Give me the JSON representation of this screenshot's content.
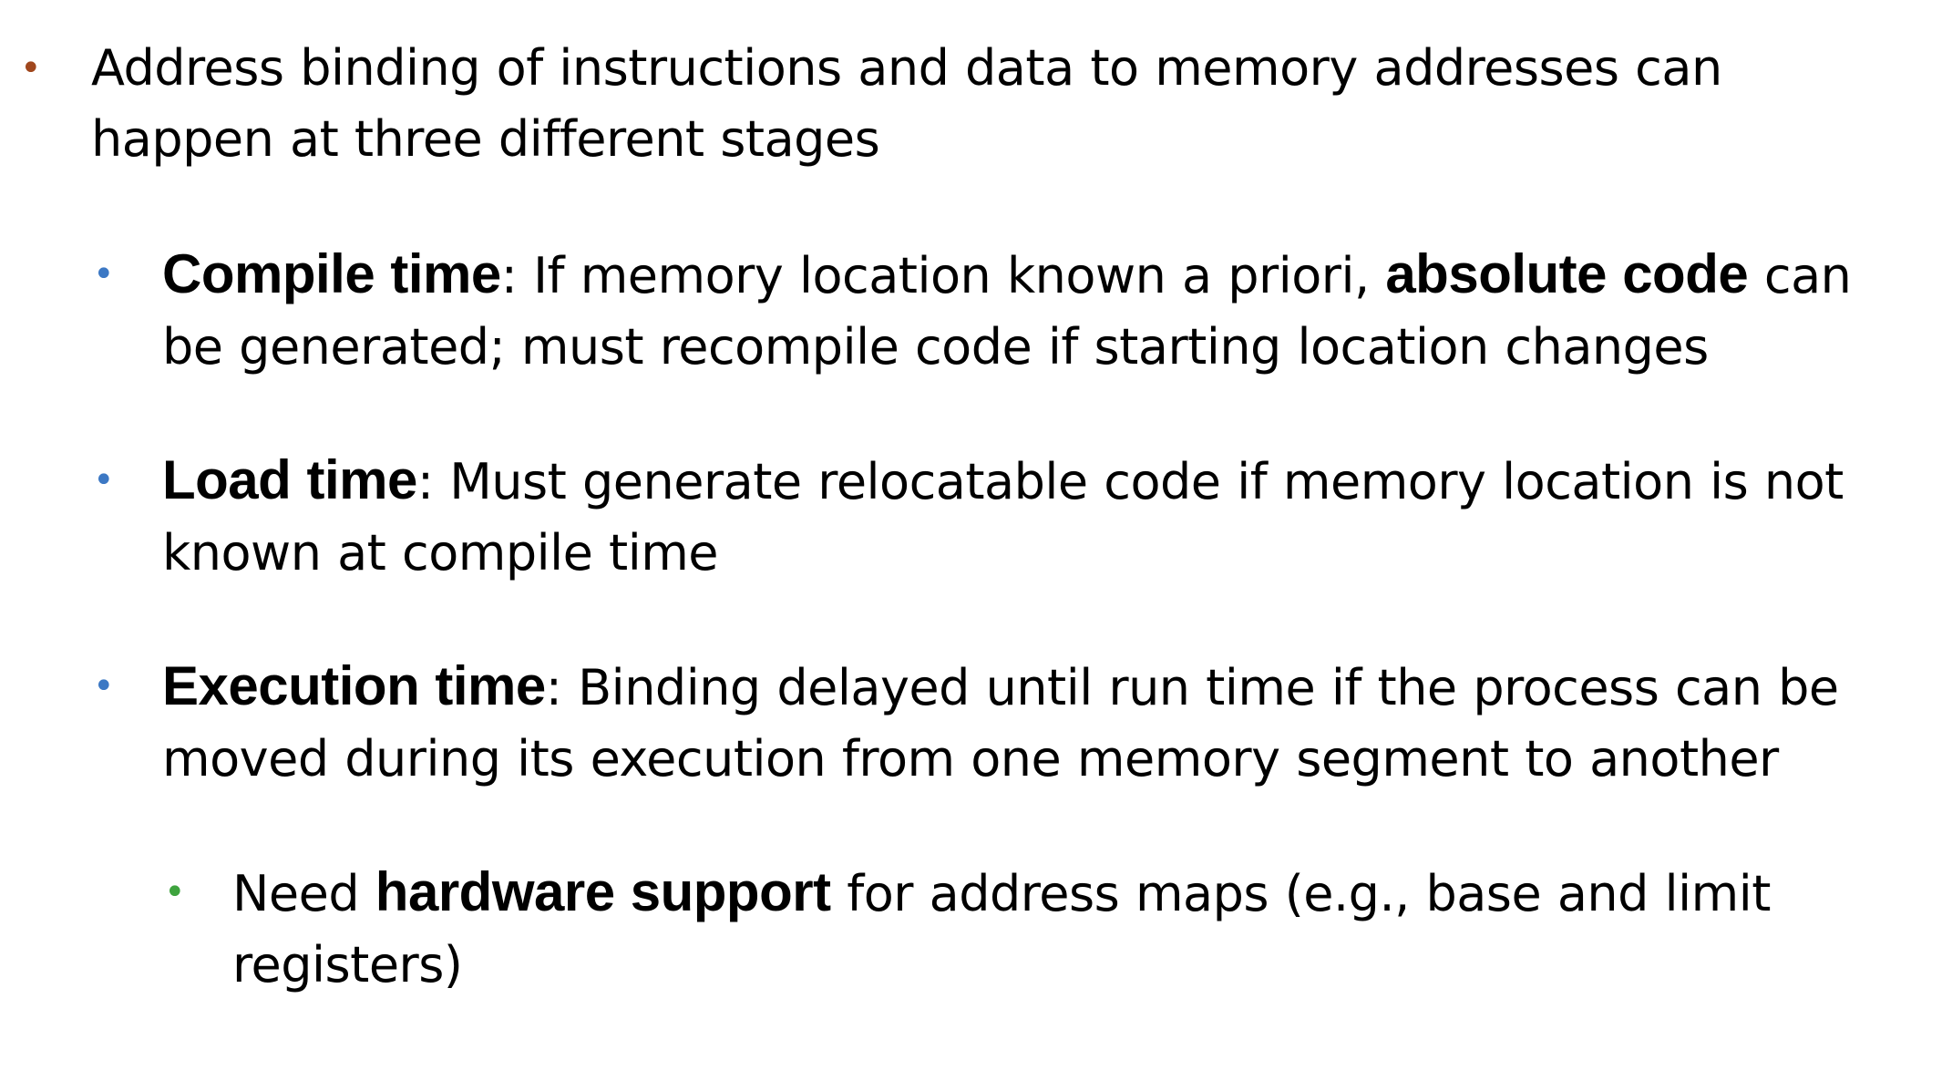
{
  "colors": {
    "level1_bullet": "#a0471d",
    "level2_bullet": "#3c78c4",
    "level3_bullet": "#3ea33e",
    "text": "#000000",
    "background": "#ffffff"
  },
  "bullets": {
    "level1": "•",
    "level2": "•",
    "level3": "•"
  },
  "items": [
    {
      "text": "Address binding of instructions and data to memory addresses can happen at three different stages"
    },
    {
      "term": "Compile time",
      "text_a": ": If memory location known a priori, ",
      "emphasis": "absolute code",
      "text_b": " can be generated; must recompile code if starting location changes"
    },
    {
      "term": "Load time",
      "text": ": Must generate relocatable code if memory location is not known at compile time"
    },
    {
      "term": "Execution time",
      "text": ": Binding delayed until run time if the process can be moved during its execution from one memory segment to another"
    },
    {
      "text_a": "Need ",
      "emphasis": "hardware support",
      "text_b": " for address maps (e.g., base and limit registers)"
    }
  ]
}
